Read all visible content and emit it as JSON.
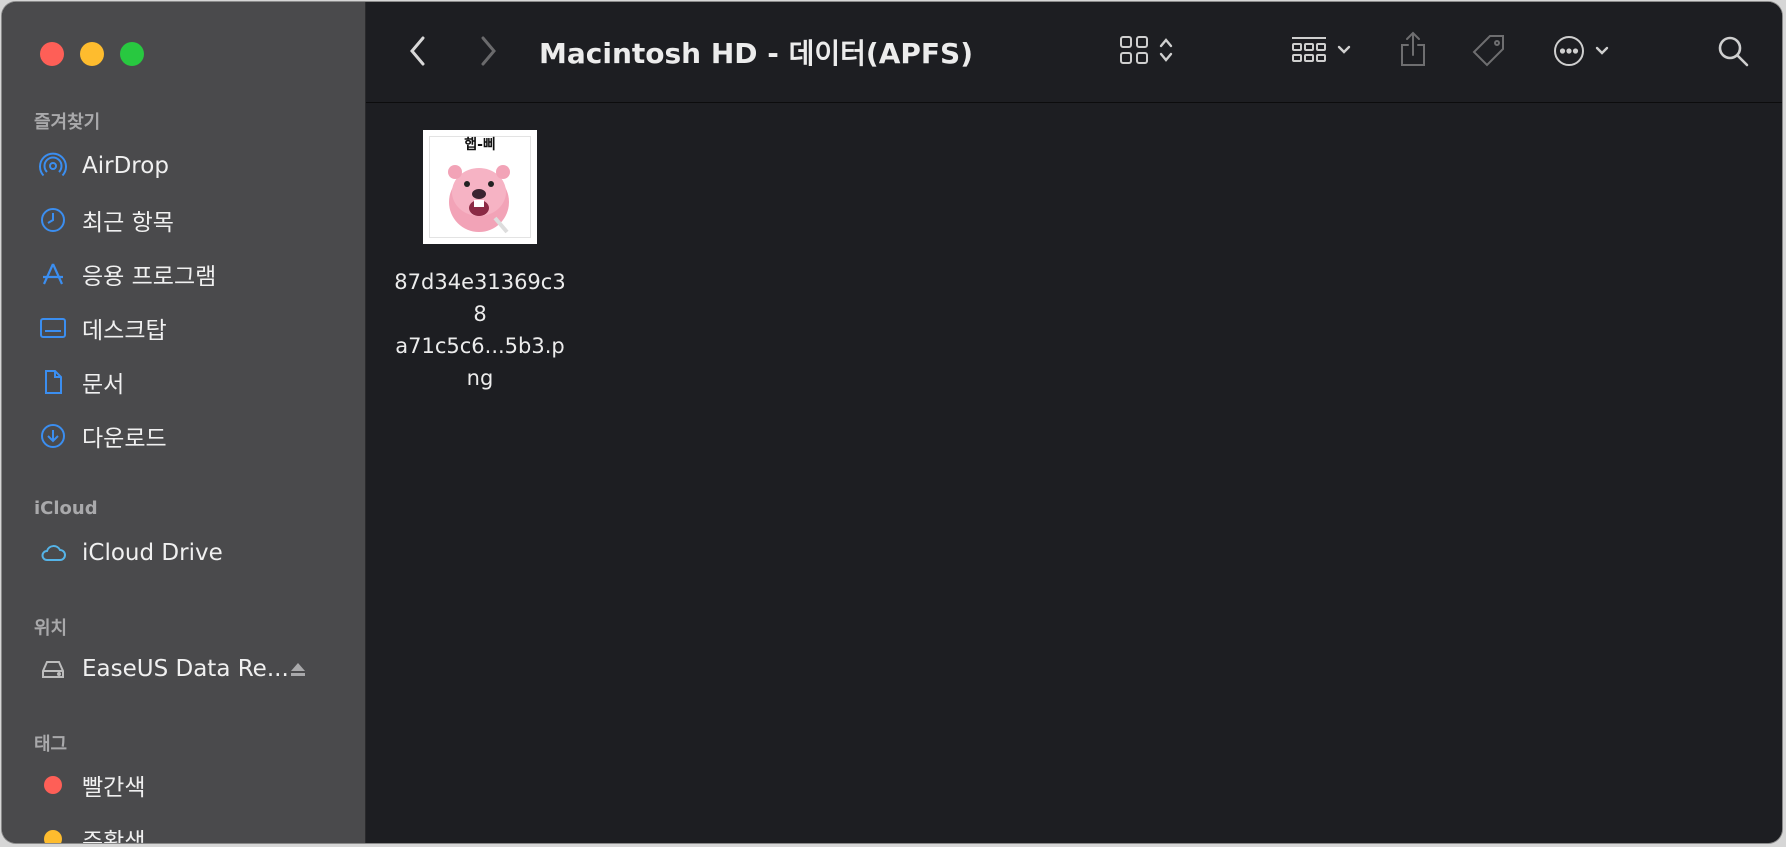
{
  "window": {
    "title": "Macintosh HD - 데이터(APFS)"
  },
  "sidebar": {
    "favorites_title": "즐겨찾기",
    "favorites": [
      {
        "label": "AirDrop",
        "icon": "airdrop-icon"
      },
      {
        "label": "최근 항목",
        "icon": "clock-icon"
      },
      {
        "label": "응용 프로그램",
        "icon": "applications-icon"
      },
      {
        "label": "데스크탑",
        "icon": "desktop-icon"
      },
      {
        "label": "문서",
        "icon": "document-icon"
      },
      {
        "label": "다운로드",
        "icon": "download-icon"
      }
    ],
    "icloud_title": "iCloud",
    "icloud": [
      {
        "label": "iCloud Drive",
        "icon": "cloud-icon"
      }
    ],
    "locations_title": "위치",
    "locations": [
      {
        "label": "EaseUS Data Re...",
        "icon": "drive-icon"
      }
    ],
    "tags_title": "태그",
    "tags": [
      {
        "label": "빨간색",
        "color": "#fe5f57"
      },
      {
        "label": "주황색",
        "color": "#febc2e"
      }
    ]
  },
  "files": [
    {
      "thumb_text": "햅-삐",
      "name_line1": "87d34e31369c38",
      "name_line2": "a71c5c6...5b3.png"
    }
  ],
  "colors": {
    "accent": "#3b8ef0",
    "sidebar_bg": "#4a4a4c",
    "main_bg": "#1d1e22"
  }
}
